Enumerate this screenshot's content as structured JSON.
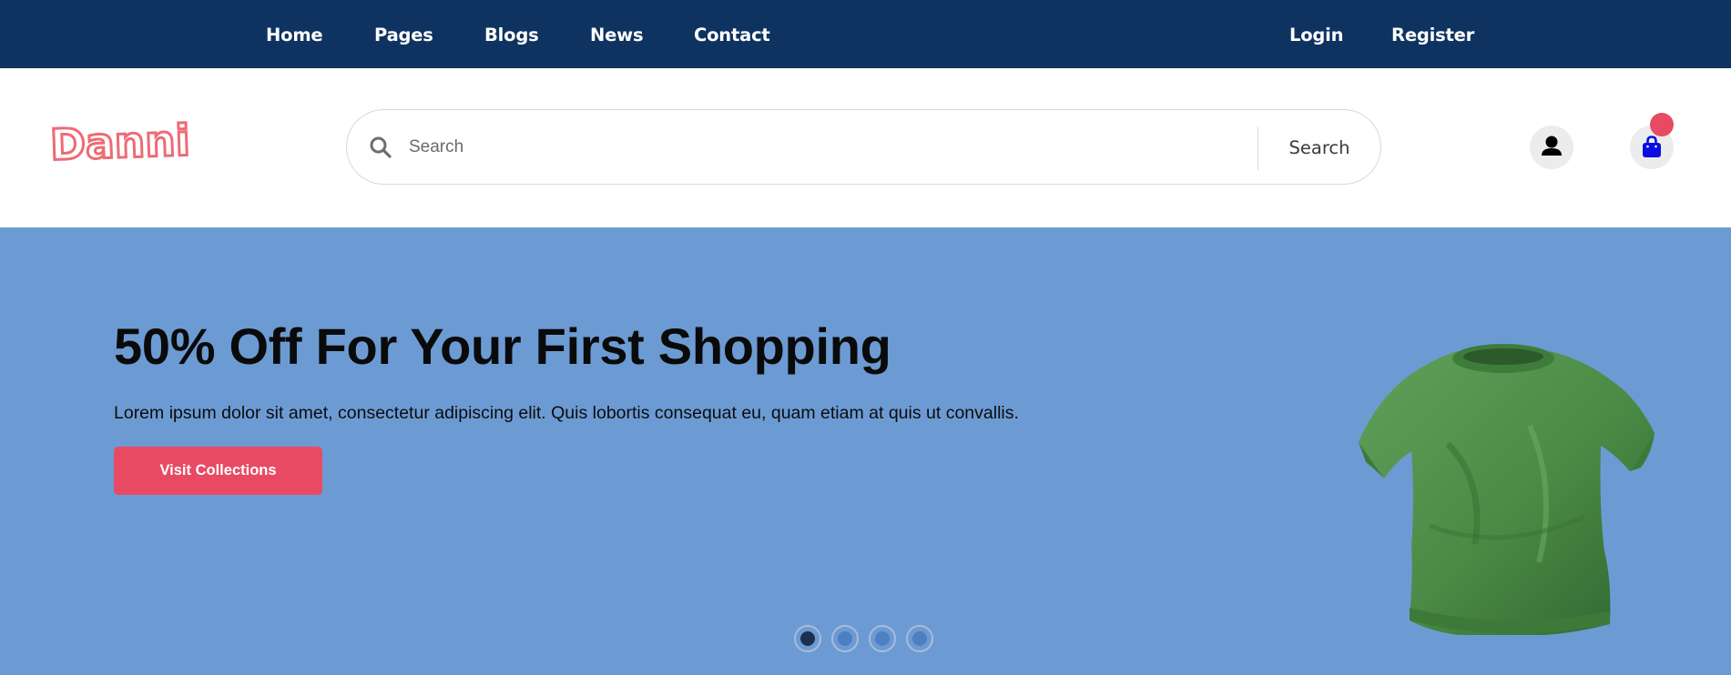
{
  "nav": {
    "items": [
      "Home",
      "Pages",
      "Blogs",
      "News",
      "Contact"
    ],
    "login": "Login",
    "register": "Register"
  },
  "header": {
    "logo": "Danni",
    "search": {
      "placeholder": "Search",
      "value": "",
      "button": "Search"
    },
    "icons": {
      "user": "user-icon",
      "cart": "shopping-bag-icon"
    }
  },
  "hero": {
    "title": "50% Off For Your First Shopping",
    "text": "Lorem ipsum dolor sit amet, consectetur adipiscing elit. Quis lobortis consequat eu, quam etiam at quis ut convallis.",
    "button": "Visit Collections",
    "image": "green-tshirt-image",
    "slides_total": 4,
    "active_slide": 1
  },
  "colors": {
    "topbar": "#0f3361",
    "hero_bg": "#6c9bd4",
    "accent": "#e84a64",
    "cart_icon": "#0a0fe0",
    "logo_outline": "#ee6a74",
    "tshirt_green": "#4f8f4a"
  }
}
